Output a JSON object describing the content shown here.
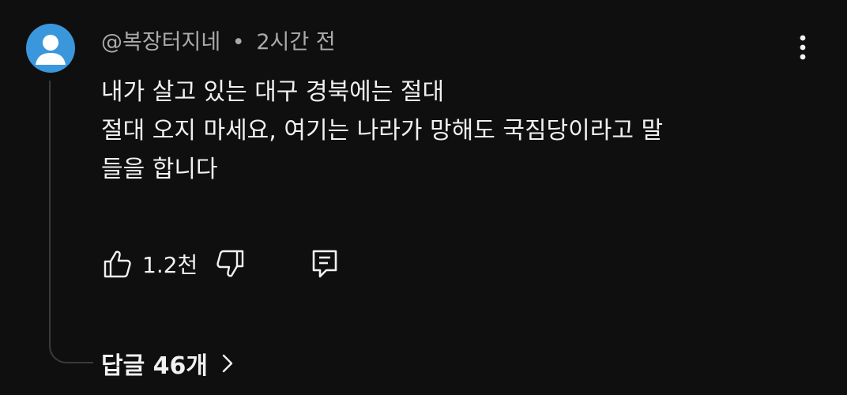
{
  "comment": {
    "author": "@복장터지네",
    "separator": "•",
    "time": "2시간 전",
    "lines": [
      "내가 살고 있는 대구 경북에는 절대",
      "절대 오지 마세요, 여기는 나라가 망해도 국짐당이라고 말",
      "들을 합니다"
    ],
    "like_count": "1.2천",
    "replies_label": "답글 46개"
  },
  "icons": {
    "avatar": "default-avatar-icon",
    "more": "vertical-ellipsis-icon",
    "like": "thumbs-up-icon",
    "dislike": "thumbs-down-icon",
    "reply": "comment-reply-icon",
    "expand": "chevron-right-icon"
  },
  "colors": {
    "background": "#0f0f0f",
    "text": "#f1f1f1",
    "meta_text": "#aaaaaa",
    "avatar_bg": "#3b97dc",
    "thread_line": "#3a3a3a"
  }
}
